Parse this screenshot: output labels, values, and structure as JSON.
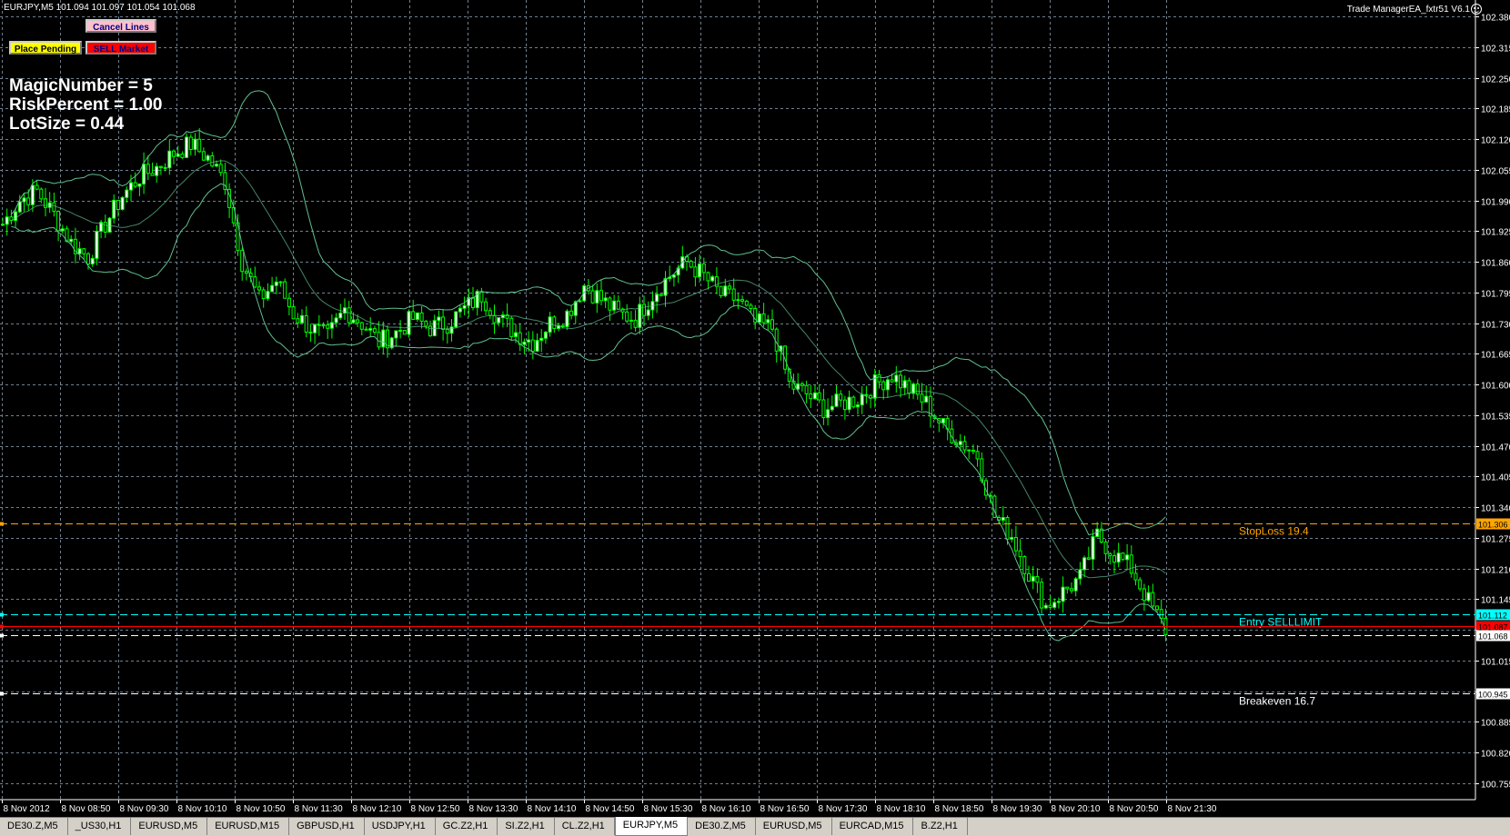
{
  "header": {
    "ohlc": "EURJPY,M5  101.094 101.097 101.054 101.068",
    "ea_name": "Trade ManagerEA_fxtr51 V6.1"
  },
  "buttons": {
    "cancel_lines": "Cancel Lines",
    "place_pending": "Place Pending",
    "sell_market": "SELL Market"
  },
  "info": {
    "magic": "MagicNumber = 5",
    "risk": "RiskPercent = 1.00",
    "lot": "LotSize = 0.44"
  },
  "chart_data": {
    "type": "candlestick",
    "symbol": "EURJPY",
    "timeframe": "M5",
    "ylim": [
      100.72,
      102.415
    ],
    "y_ticks": [
      102.38,
      102.315,
      102.25,
      102.185,
      102.12,
      102.055,
      101.99,
      101.925,
      101.86,
      101.795,
      101.73,
      101.665,
      101.6,
      101.535,
      101.47,
      101.405,
      101.34,
      101.275,
      101.21,
      101.145,
      101.08,
      101.015,
      100.95,
      100.885,
      100.82,
      100.755
    ],
    "x_ticks": [
      "8 Nov 2012",
      "8 Nov 08:50",
      "8 Nov 09:30",
      "8 Nov 10:10",
      "8 Nov 10:50",
      "8 Nov 11:30",
      "8 Nov 12:10",
      "8 Nov 12:50",
      "8 Nov 13:30",
      "8 Nov 14:10",
      "8 Nov 14:50",
      "8 Nov 15:30",
      "8 Nov 16:10",
      "8 Nov 16:50",
      "8 Nov 17:30",
      "8 Nov 18:10",
      "8 Nov 18:50",
      "8 Nov 19:30",
      "8 Nov 20:10",
      "8 Nov 20:50",
      "8 Nov 21:30"
    ],
    "close_path": [
      [
        0,
        101.94
      ],
      [
        4,
        101.99
      ],
      [
        8,
        102.01
      ],
      [
        12,
        101.96
      ],
      [
        16,
        101.9
      ],
      [
        20,
        101.87
      ],
      [
        24,
        101.94
      ],
      [
        28,
        102.0
      ],
      [
        32,
        102.04
      ],
      [
        36,
        102.06
      ],
      [
        40,
        102.09
      ],
      [
        44,
        102.11
      ],
      [
        48,
        102.08
      ],
      [
        52,
        102.03
      ],
      [
        56,
        101.86
      ],
      [
        60,
        101.78
      ],
      [
        64,
        101.82
      ],
      [
        68,
        101.75
      ],
      [
        72,
        101.72
      ],
      [
        76,
        101.7
      ],
      [
        80,
        101.76
      ],
      [
        84,
        101.73
      ],
      [
        88,
        101.69
      ],
      [
        92,
        101.71
      ],
      [
        96,
        101.74
      ],
      [
        100,
        101.72
      ],
      [
        104,
        101.73
      ],
      [
        108,
        101.76
      ],
      [
        112,
        101.79
      ],
      [
        116,
        101.74
      ],
      [
        120,
        101.71
      ],
      [
        124,
        101.69
      ],
      [
        128,
        101.73
      ],
      [
        132,
        101.75
      ],
      [
        136,
        101.81
      ],
      [
        140,
        101.78
      ],
      [
        144,
        101.75
      ],
      [
        148,
        101.74
      ],
      [
        152,
        101.79
      ],
      [
        156,
        101.83
      ],
      [
        160,
        101.86
      ],
      [
        164,
        101.83
      ],
      [
        168,
        101.79
      ],
      [
        172,
        101.78
      ],
      [
        176,
        101.73
      ],
      [
        180,
        101.72
      ],
      [
        184,
        101.6
      ],
      [
        188,
        101.58
      ],
      [
        192,
        101.55
      ],
      [
        196,
        101.56
      ],
      [
        200,
        101.57
      ],
      [
        204,
        101.6
      ],
      [
        208,
        101.62
      ],
      [
        212,
        101.59
      ],
      [
        216,
        101.56
      ],
      [
        220,
        101.51
      ],
      [
        224,
        101.48
      ],
      [
        228,
        101.45
      ],
      [
        232,
        101.32
      ],
      [
        236,
        101.28
      ],
      [
        240,
        101.2
      ],
      [
        244,
        101.13
      ],
      [
        248,
        101.16
      ],
      [
        252,
        101.19
      ],
      [
        256,
        101.28
      ],
      [
        260,
        101.24
      ],
      [
        264,
        101.21
      ],
      [
        268,
        101.14
      ],
      [
        272,
        101.08
      ]
    ],
    "levels": [
      {
        "label": "StopLoss  19.4",
        "price": 101.306,
        "axis_label": "101.306",
        "color": "#ffa500",
        "axis_bg": "#ffa500"
      },
      {
        "label": "Entry SELLLIMIT",
        "price": 101.112,
        "axis_label": "101.112",
        "color": "#00ffff",
        "axis_bg": "#00ffff"
      },
      {
        "label": "",
        "price": 101.087,
        "axis_label": "101.087",
        "color": "#ff0000",
        "axis_bg": "#ff0000"
      },
      {
        "label": "",
        "price": 101.068,
        "axis_label": "101.068",
        "color": "#ffffff",
        "axis_bg": "#ffffff"
      },
      {
        "label": "Breakeven  16.7",
        "price": 100.945,
        "axis_label": "100.945",
        "color": "#ffffff",
        "axis_bg": "#ffffff"
      }
    ]
  },
  "tabs": [
    {
      "label": "DE30.Z,M5",
      "active": false
    },
    {
      "label": "_US30,H1",
      "active": false
    },
    {
      "label": "EURUSD,M5",
      "active": false
    },
    {
      "label": "EURUSD,M15",
      "active": false
    },
    {
      "label": "GBPUSD,H1",
      "active": false
    },
    {
      "label": "USDJPY,H1",
      "active": false
    },
    {
      "label": "GC.Z2,H1",
      "active": false
    },
    {
      "label": "SI.Z2,H1",
      "active": false
    },
    {
      "label": "CL.Z2,H1",
      "active": false
    },
    {
      "label": "EURJPY,M5",
      "active": true
    },
    {
      "label": "DE30.Z,M5",
      "active": false
    },
    {
      "label": "EURUSD,M5",
      "active": false
    },
    {
      "label": "EURCAD,M15",
      "active": false
    },
    {
      "label": "B.Z2,H1",
      "active": false
    }
  ],
  "colors": {
    "candle": "#00ff00",
    "candle_up_fill": "#ffffff",
    "grid": "#708090",
    "axis": "#ffffff",
    "band": "#5fbf8f"
  }
}
